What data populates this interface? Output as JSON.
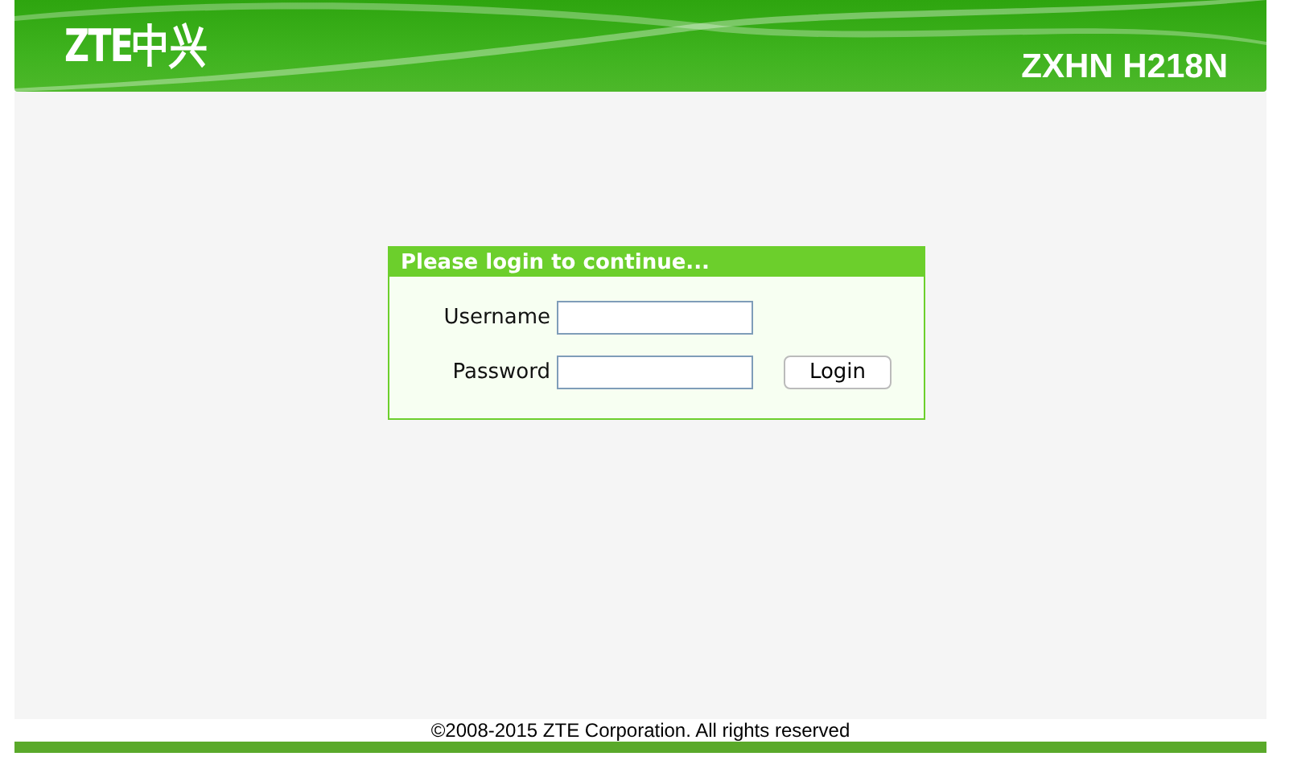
{
  "header": {
    "logo": "ZTE中兴",
    "model": "ZXHN H218N"
  },
  "login": {
    "title": "Please login to continue...",
    "fields": [
      {
        "label": "Username"
      },
      {
        "label": "Password"
      }
    ],
    "button": "Login"
  },
  "footer": {
    "copyright": "©2008-2015 ZTE Corporation. All rights reserved"
  }
}
